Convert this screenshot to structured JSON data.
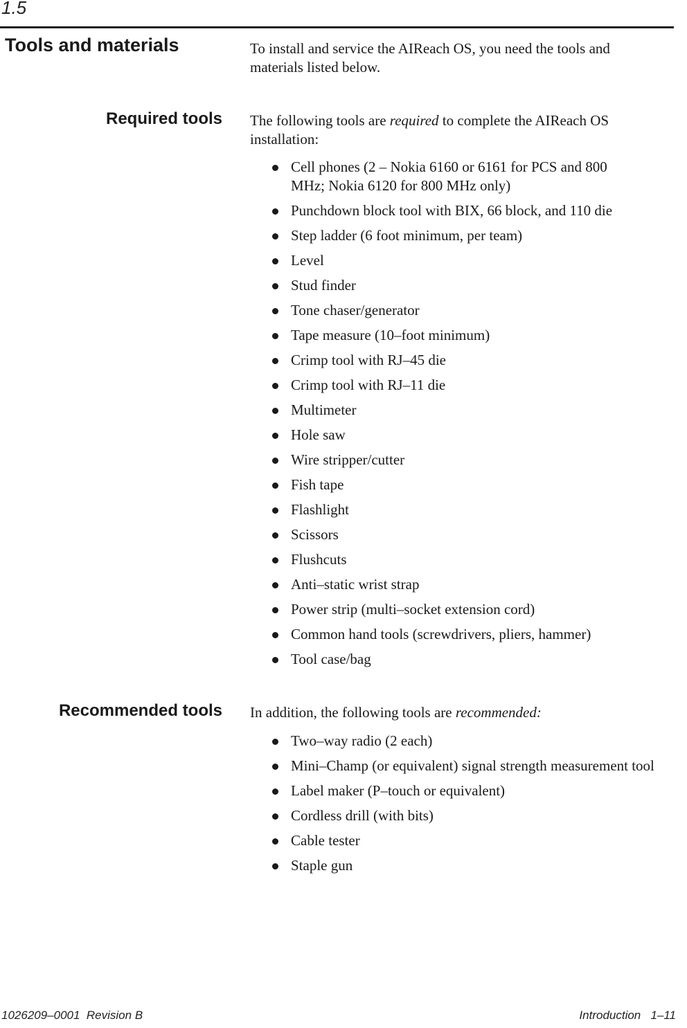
{
  "header": {
    "section_number": "1.5"
  },
  "sections": {
    "tools_and_materials": {
      "heading": "Tools and materials",
      "intro": "To install and service the AIReach OS, you need the tools and materials listed below."
    },
    "required_tools": {
      "heading": "Required tools",
      "intro_before": "The following tools are ",
      "intro_emphasis": "required",
      "intro_after": " to complete the AIReach OS installation:",
      "items": [
        "Cell phones (2 – Nokia 6160 or 6161 for PCS and 800 MHz; Nokia 6120 for 800 MHz only)",
        "Punchdown block tool with BIX, 66 block, and 110 die",
        "Step ladder (6 foot minimum, per team)",
        "Level",
        "Stud finder",
        "Tone chaser/generator",
        "Tape measure (10–foot minimum)",
        "Crimp tool with RJ–45 die",
        "Crimp tool with RJ–11 die",
        "Multimeter",
        "Hole saw",
        "Wire stripper/cutter",
        "Fish tape",
        "Flashlight",
        "Scissors",
        "Flushcuts",
        "Anti–static wrist strap",
        "Power strip (multi–socket extension cord)",
        "Common hand tools (screwdrivers, pliers, hammer)",
        "Tool case/bag"
      ]
    },
    "recommended_tools": {
      "heading": "Recommended tools",
      "intro_before": "In addition, the following tools are ",
      "intro_emphasis": "recommended:",
      "items": [
        "Two–way radio (2 each)",
        "Mini–Champ (or equivalent) signal strength measurement tool",
        "Label maker (P–touch or equivalent)",
        "Cordless drill (with bits)",
        "Cable tester",
        "Staple gun"
      ]
    }
  },
  "footer": {
    "document_id": "1026209–0001  Revision B",
    "chapter": "Introduction",
    "page": "1–11"
  }
}
